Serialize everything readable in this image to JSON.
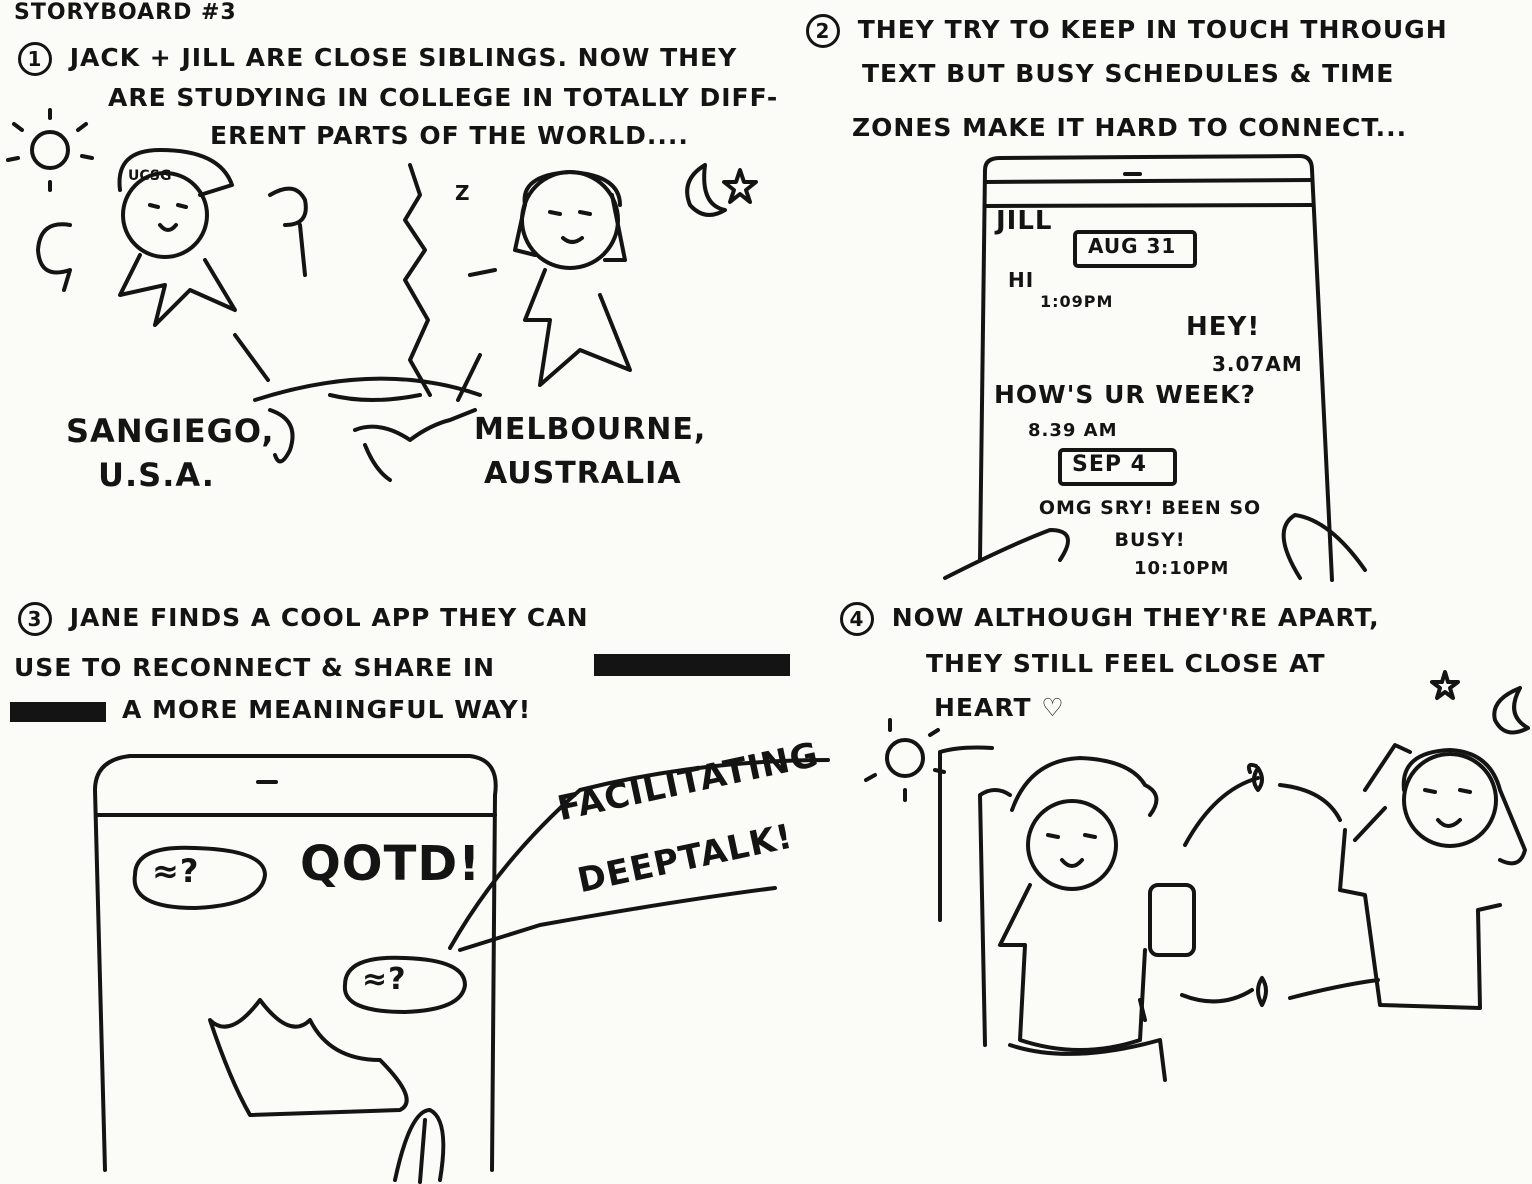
{
  "title": "STORYBOARD #3",
  "panels": [
    {
      "number": "1",
      "caption_lines": [
        "JACK + JILL ARE CLOSE SIBLINGS. NOW THEY",
        "ARE STUDYING IN COLLEGE IN TOTALLY DIFF-",
        "ERENT PARTS OF THE WORLD...."
      ],
      "cap_label": "UCSG",
      "sleep_label": "Z",
      "location_left": [
        "SANGIEGO,",
        "U.S.A."
      ],
      "location_right": [
        "MELBOURNE,",
        "AUSTRALIA"
      ]
    },
    {
      "number": "2",
      "caption_lines": [
        "THEY TRY TO KEEP IN TOUCH THROUGH",
        "TEXT BUT BUSY SCHEDULES & TIME",
        "ZONES MAKE IT HARD TO CONNECT..."
      ],
      "phone": {
        "contact": "JILL",
        "messages": [
          {
            "kind": "date",
            "text": "AUG 31"
          },
          {
            "kind": "left",
            "text": "HI",
            "time": "1:09PM"
          },
          {
            "kind": "right",
            "text": "HEY!",
            "time": "3.07AM"
          },
          {
            "kind": "left",
            "text": "HOW'S UR WEEK?",
            "time": "8.39 AM"
          },
          {
            "kind": "date",
            "text": "SEP 4"
          },
          {
            "kind": "right",
            "text": "OMG SRY! BEEN SO BUSY!",
            "time": "10:10PM"
          }
        ]
      }
    },
    {
      "number": "3",
      "caption_lines": [
        "JANE FINDS A COOL APP THEY CAN",
        "USE TO RECONNECT & SHARE IN",
        "A MORE MEANINGFUL WAY!"
      ],
      "app_label": "QOTD!",
      "bubble_symbol": "≈?",
      "speech_bubble": [
        "FACILITATING",
        "DEEPTALK!"
      ]
    },
    {
      "number": "4",
      "caption_lines": [
        "NOW ALTHOUGH THEY'RE APART,",
        "THEY STILL FEEL CLOSE AT",
        "HEART ♡"
      ]
    }
  ],
  "icons": [
    "sun-icon",
    "moon-icon",
    "star-icon",
    "heart-icon",
    "globe-icon",
    "phone-icon"
  ]
}
